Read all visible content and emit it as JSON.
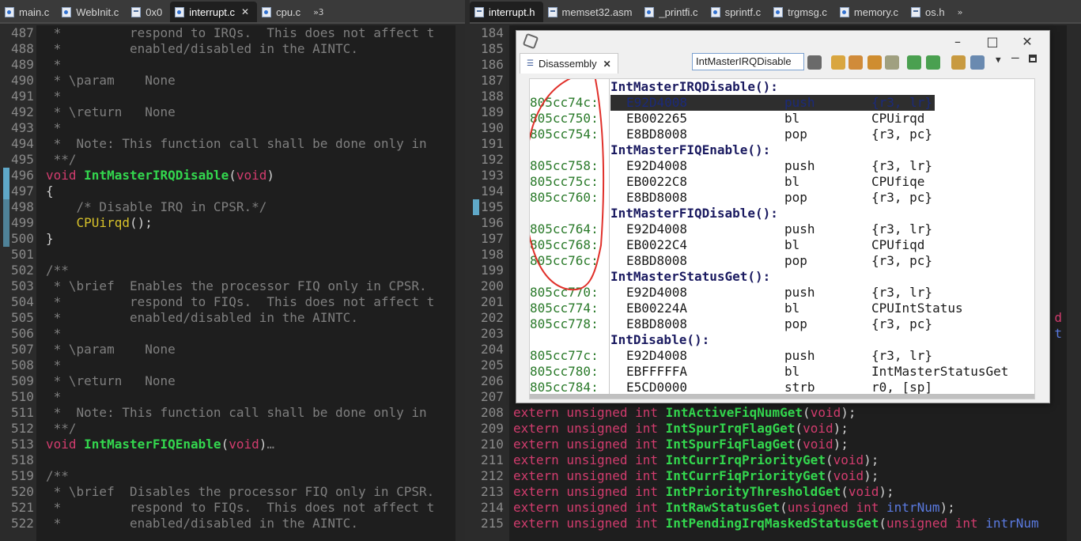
{
  "left_tabs": [
    {
      "label": "main.c",
      "active": false,
      "closable": false
    },
    {
      "label": "WebInit.c",
      "active": false,
      "closable": false
    },
    {
      "label": "0x0",
      "active": false,
      "closable": false
    },
    {
      "label": "interrupt.c",
      "active": true,
      "closable": true
    },
    {
      "label": "cpu.c",
      "active": false,
      "closable": false
    }
  ],
  "left_overflow": "»3",
  "right_tabs": [
    {
      "label": "interrupt.h",
      "active": true,
      "closable": false
    },
    {
      "label": "memset32.asm",
      "active": false,
      "closable": false
    },
    {
      "label": "_printfi.c",
      "active": false,
      "closable": false
    },
    {
      "label": "sprintf.c",
      "active": false,
      "closable": false
    },
    {
      "label": "trgmsg.c",
      "active": false,
      "closable": false
    },
    {
      "label": "memory.c",
      "active": false,
      "closable": false
    },
    {
      "label": "os.h",
      "active": false,
      "closable": false
    }
  ],
  "right_overflow": "»",
  "left_editor": {
    "lines": [
      {
        "n": "487",
        "segs": [
          [
            " *         respond to IRQs.  This does not affect t",
            "cm"
          ]
        ]
      },
      {
        "n": "488",
        "segs": [
          [
            " *         enabled/disabled in the AINTC.",
            "cm"
          ]
        ]
      },
      {
        "n": "489",
        "segs": [
          [
            " *",
            "cm"
          ]
        ]
      },
      {
        "n": "490",
        "segs": [
          [
            " * \\param    None",
            "cm"
          ]
        ]
      },
      {
        "n": "491",
        "segs": [
          [
            " *",
            "cm"
          ]
        ]
      },
      {
        "n": "492",
        "segs": [
          [
            " * \\return   None",
            "cm"
          ]
        ]
      },
      {
        "n": "493",
        "segs": [
          [
            " *",
            "cm"
          ]
        ]
      },
      {
        "n": "494",
        "segs": [
          [
            " *  Note: This function call shall be done only in",
            "cm"
          ]
        ]
      },
      {
        "n": "495",
        "segs": [
          [
            " **/",
            "cm"
          ]
        ]
      },
      {
        "n": "496",
        "segs": [
          [
            "void ",
            "kw"
          ],
          [
            "IntMasterIRQDisable",
            "fn"
          ],
          [
            "(",
            "pn"
          ],
          [
            "void",
            "kw"
          ],
          [
            ")",
            "pn"
          ]
        ]
      },
      {
        "n": "497",
        "segs": [
          [
            "{",
            "pn"
          ]
        ]
      },
      {
        "n": "498",
        "segs": [
          [
            "    /* Disable IRQ in CPSR.*/",
            "cm"
          ]
        ]
      },
      {
        "n": "499",
        "segs": [
          [
            "    ",
            "pn"
          ],
          [
            "CPUirqd",
            "call"
          ],
          [
            "();",
            "pn"
          ]
        ]
      },
      {
        "n": "500",
        "segs": [
          [
            "}",
            "pn"
          ]
        ]
      },
      {
        "n": "501",
        "segs": [
          [
            "",
            "pn"
          ]
        ]
      },
      {
        "n": "502",
        "segs": [
          [
            "/**",
            "cm"
          ]
        ]
      },
      {
        "n": "503",
        "segs": [
          [
            " * \\brief  Enables the processor FIQ only in CPSR.",
            "cm"
          ]
        ]
      },
      {
        "n": "504",
        "segs": [
          [
            " *         respond to FIQs.  This does not affect t",
            "cm"
          ]
        ]
      },
      {
        "n": "505",
        "segs": [
          [
            " *         enabled/disabled in the AINTC.",
            "cm"
          ]
        ]
      },
      {
        "n": "506",
        "segs": [
          [
            " *",
            "cm"
          ]
        ]
      },
      {
        "n": "507",
        "segs": [
          [
            " * \\param    None",
            "cm"
          ]
        ]
      },
      {
        "n": "508",
        "segs": [
          [
            " *",
            "cm"
          ]
        ]
      },
      {
        "n": "509",
        "segs": [
          [
            " * \\return   None",
            "cm"
          ]
        ]
      },
      {
        "n": "510",
        "segs": [
          [
            " *",
            "cm"
          ]
        ]
      },
      {
        "n": "511",
        "segs": [
          [
            " *  Note: This function call shall be done only in",
            "cm"
          ]
        ]
      },
      {
        "n": "512",
        "segs": [
          [
            " **/",
            "cm"
          ]
        ]
      },
      {
        "n": "513",
        "segs": [
          [
            "void ",
            "kw"
          ],
          [
            "IntMasterFIQEnable",
            "fn"
          ],
          [
            "(",
            "pn"
          ],
          [
            "void",
            "kw"
          ],
          [
            ")",
            "pn"
          ],
          [
            "…",
            "cm"
          ]
        ]
      },
      {
        "n": "518",
        "segs": [
          [
            "",
            "pn"
          ]
        ]
      },
      {
        "n": "519",
        "segs": [
          [
            "/**",
            "cm"
          ]
        ]
      },
      {
        "n": "520",
        "segs": [
          [
            " * \\brief  Disables the processor FIQ only in CPSR.",
            "cm"
          ]
        ]
      },
      {
        "n": "521",
        "segs": [
          [
            " *         respond to FIQs.  This does not affect t",
            "cm"
          ]
        ]
      },
      {
        "n": "522",
        "segs": [
          [
            " *         enabled/disabled in the AINTC.",
            "cm"
          ]
        ]
      }
    ]
  },
  "right_editor": {
    "lines": [
      {
        "n": "184",
        "segs": []
      },
      {
        "n": "185",
        "segs": []
      },
      {
        "n": "186",
        "segs": []
      },
      {
        "n": "187",
        "segs": []
      },
      {
        "n": "188",
        "segs": []
      },
      {
        "n": "189",
        "segs": []
      },
      {
        "n": "190",
        "segs": []
      },
      {
        "n": "191",
        "segs": []
      },
      {
        "n": "192",
        "segs": []
      },
      {
        "n": "193",
        "segs": []
      },
      {
        "n": "194",
        "segs": []
      },
      {
        "n": "195",
        "segs": []
      },
      {
        "n": "196",
        "segs": []
      },
      {
        "n": "197",
        "segs": []
      },
      {
        "n": "198",
        "segs": []
      },
      {
        "n": "199",
        "segs": []
      },
      {
        "n": "200",
        "segs": []
      },
      {
        "n": "201",
        "segs": []
      },
      {
        "n": "202",
        "segs": []
      },
      {
        "n": "203",
        "segs": []
      },
      {
        "n": "204",
        "segs": []
      },
      {
        "n": "205",
        "segs": []
      },
      {
        "n": "206",
        "segs": []
      },
      {
        "n": "207",
        "segs": []
      },
      {
        "n": "208",
        "segs": [
          [
            "extern unsigned int ",
            "kw"
          ],
          [
            "IntActiveFiqNumGet",
            "fn"
          ],
          [
            "(",
            "pn"
          ],
          [
            "void",
            "kw"
          ],
          [
            ");",
            "pn"
          ]
        ]
      },
      {
        "n": "209",
        "segs": [
          [
            "extern unsigned int ",
            "kw"
          ],
          [
            "IntSpurIrqFlagGet",
            "fn"
          ],
          [
            "(",
            "pn"
          ],
          [
            "void",
            "kw"
          ],
          [
            ");",
            "pn"
          ]
        ]
      },
      {
        "n": "210",
        "segs": [
          [
            "extern unsigned int ",
            "kw"
          ],
          [
            "IntSpurFiqFlagGet",
            "fn"
          ],
          [
            "(",
            "pn"
          ],
          [
            "void",
            "kw"
          ],
          [
            ");",
            "pn"
          ]
        ]
      },
      {
        "n": "211",
        "segs": [
          [
            "extern unsigned int ",
            "kw"
          ],
          [
            "IntCurrIrqPriorityGet",
            "fn"
          ],
          [
            "(",
            "pn"
          ],
          [
            "void",
            "kw"
          ],
          [
            ");",
            "pn"
          ]
        ]
      },
      {
        "n": "212",
        "segs": [
          [
            "extern unsigned int ",
            "kw"
          ],
          [
            "IntCurrFiqPriorityGet",
            "fn"
          ],
          [
            "(",
            "pn"
          ],
          [
            "void",
            "kw"
          ],
          [
            ");",
            "pn"
          ]
        ]
      },
      {
        "n": "213",
        "segs": [
          [
            "extern unsigned int ",
            "kw"
          ],
          [
            "IntPriorityThresholdGet",
            "fn"
          ],
          [
            "(",
            "pn"
          ],
          [
            "void",
            "kw"
          ],
          [
            ");",
            "pn"
          ]
        ]
      },
      {
        "n": "214",
        "segs": [
          [
            "extern unsigned int ",
            "kw"
          ],
          [
            "IntRawStatusGet",
            "fn"
          ],
          [
            "(",
            "pn"
          ],
          [
            "unsigned int ",
            "kw"
          ],
          [
            "intrNum",
            "pa"
          ],
          [
            ");",
            "pn"
          ]
        ]
      },
      {
        "n": "215",
        "segs": [
          [
            "extern unsigned int ",
            "kw"
          ],
          [
            "IntPendingIrqMaskedStatusGet",
            "fn"
          ],
          [
            "(",
            "pn"
          ],
          [
            "unsigned int ",
            "kw"
          ],
          [
            "intrNum",
            "pa"
          ]
        ]
      }
    ],
    "edge_chars": [
      {
        "row": 18,
        "ch": "d",
        "color": "#d23c6e"
      },
      {
        "row": 19,
        "ch": "t",
        "color": "#5a7ae0"
      }
    ]
  },
  "disassembly": {
    "tab_label": "Disassembly",
    "address_input": "IntMasterIRQDisable",
    "rows": [
      {
        "type": "fn",
        "text": "IntMasterIRQDisable():"
      },
      {
        "type": "ins",
        "addr": "805cc74c:",
        "op": "E92D4008",
        "mn": "push",
        "args": "{r3, lr}",
        "current": true
      },
      {
        "type": "ins",
        "addr": "805cc750:",
        "op": "EB002265",
        "mn": "bl",
        "args": "CPUirqd"
      },
      {
        "type": "ins",
        "addr": "805cc754:",
        "op": "E8BD8008",
        "mn": "pop",
        "args": "{r3, pc}"
      },
      {
        "type": "fn",
        "text": "IntMasterFIQEnable():"
      },
      {
        "type": "ins",
        "addr": "805cc758:",
        "op": "E92D4008",
        "mn": "push",
        "args": "{r3, lr}"
      },
      {
        "type": "ins",
        "addr": "805cc75c:",
        "op": "EB0022C8",
        "mn": "bl",
        "args": "CPUfiqe"
      },
      {
        "type": "ins",
        "addr": "805cc760:",
        "op": "E8BD8008",
        "mn": "pop",
        "args": "{r3, pc}"
      },
      {
        "type": "fn",
        "text": "IntMasterFIQDisable():"
      },
      {
        "type": "ins",
        "addr": "805cc764:",
        "op": "E92D4008",
        "mn": "push",
        "args": "{r3, lr}"
      },
      {
        "type": "ins",
        "addr": "805cc768:",
        "op": "EB0022C4",
        "mn": "bl",
        "args": "CPUfiqd"
      },
      {
        "type": "ins",
        "addr": "805cc76c:",
        "op": "E8BD8008",
        "mn": "pop",
        "args": "{r3, pc}"
      },
      {
        "type": "fn",
        "text": "IntMasterStatusGet():"
      },
      {
        "type": "ins",
        "addr": "805cc770:",
        "op": "E92D4008",
        "mn": "push",
        "args": "{r3, lr}"
      },
      {
        "type": "ins",
        "addr": "805cc774:",
        "op": "EB00224A",
        "mn": "bl",
        "args": "CPUIntStatus"
      },
      {
        "type": "ins",
        "addr": "805cc778:",
        "op": "E8BD8008",
        "mn": "pop",
        "args": "{r3, pc}"
      },
      {
        "type": "fn",
        "text": "IntDisable():"
      },
      {
        "type": "ins",
        "addr": "805cc77c:",
        "op": "E92D4008",
        "mn": "push",
        "args": "{r3, lr}"
      },
      {
        "type": "ins",
        "addr": "805cc780:",
        "op": "EBFFFFFA",
        "mn": "bl",
        "args": "IntMasterStatusGet"
      },
      {
        "type": "ins",
        "addr": "805cc784:",
        "op": "E5CD0000",
        "mn": "strb",
        "args": "r0, [sp]"
      }
    ]
  },
  "colors": {
    "annotation": "#e0302a",
    "changed_marker": "#5fa8c8",
    "current_line": "#2e2e2e"
  }
}
